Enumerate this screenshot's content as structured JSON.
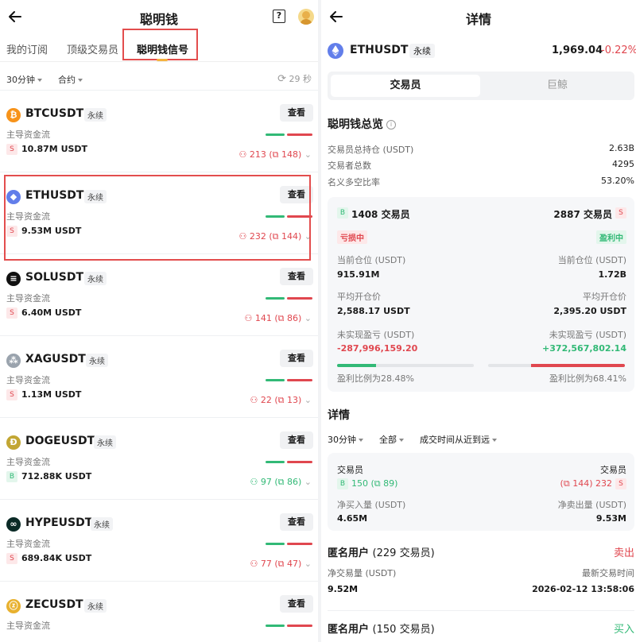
{
  "left": {
    "title": "聪明钱",
    "tabs": [
      "我的订阅",
      "顶级交易员",
      "聪明钱信号"
    ],
    "filters": {
      "interval": "30分钟",
      "type": "合约",
      "refresh": "29 秒"
    },
    "flow_label": "主导资金流",
    "perp_label": "永续",
    "view_label": "查看",
    "coins": [
      {
        "symbol": "BTCUSDT",
        "side": "S",
        "flow": "10.87M USDT",
        "traders": "213",
        "whales": "148",
        "direction": "sell",
        "icon": "btc-icon",
        "icon_color": "#f7931a",
        "glyph": "₿"
      },
      {
        "symbol": "ETHUSDT",
        "side": "S",
        "flow": "9.53M USDT",
        "traders": "232",
        "whales": "144",
        "direction": "sell",
        "icon": "eth-icon",
        "icon_color": "#627eea",
        "glyph": "◆"
      },
      {
        "symbol": "SOLUSDT",
        "side": "S",
        "flow": "6.40M USDT",
        "traders": "141",
        "whales": "86",
        "direction": "sell",
        "icon": "sol-icon",
        "icon_color": "#111111",
        "glyph": "≡"
      },
      {
        "symbol": "XAGUSDT",
        "side": "S",
        "flow": "1.13M USDT",
        "traders": "22",
        "whales": "13",
        "direction": "sell",
        "icon": "xag-icon",
        "icon_color": "#9aa3ad",
        "glyph": "⁂"
      },
      {
        "symbol": "DOGEUSDT",
        "side": "B",
        "flow": "712.88K USDT",
        "traders": "97",
        "whales": "86",
        "direction": "buy",
        "icon": "doge-icon",
        "icon_color": "#c2a633",
        "glyph": "Ð"
      },
      {
        "symbol": "HYPEUSDT",
        "side": "S",
        "flow": "689.84K USDT",
        "traders": "77",
        "whales": "47",
        "direction": "sell",
        "icon": "hype-icon",
        "icon_color": "#0a2a26",
        "glyph": "∞"
      },
      {
        "symbol": "ZECUSDT",
        "side": "S",
        "flow": "",
        "traders": "",
        "whales": "",
        "direction": "sell",
        "icon": "zec-icon",
        "icon_color": "#e8b12f",
        "glyph": "ⓩ"
      }
    ]
  },
  "right": {
    "title": "详情",
    "symbol": "ETHUSDT",
    "perp_label": "永续",
    "price": "1,969.04",
    "change": "-0.22%",
    "segments": [
      "交易员",
      "巨鲸"
    ],
    "overview": {
      "title": "聪明钱总览",
      "rows": [
        {
          "label": "交易员总持仓 (USDT)",
          "value": "2.63B"
        },
        {
          "label": "交易者总数",
          "value": "4295"
        },
        {
          "label": "名义多空比率",
          "value": "53.20%"
        }
      ]
    },
    "card1": {
      "left_count": "1408 交易员",
      "right_count": "2887 交易员",
      "left_side": "B",
      "right_side": "S",
      "left_tag": "亏损中",
      "right_tag": "盈利中",
      "position_label": "当前仓位 (USDT)",
      "left_position": "915.91M",
      "right_position": "1.72B",
      "avg_label": "平均开仓价",
      "left_avg": "2,588.17 USDT",
      "right_avg": "2,395.20 USDT",
      "pnl_label": "未实现盈亏 (USDT)",
      "left_pnl": "-287,996,159.20",
      "right_pnl": "+372,567,802.14",
      "left_ratio_text": "盈利比例为28.48%",
      "right_ratio_text": "盈利比例为68.41%",
      "left_ratio": 0.2848,
      "right_ratio": 0.6841
    },
    "details": {
      "title": "详情",
      "filters": [
        "30分钟",
        "全部",
        "成交时间从近到远"
      ],
      "card_left_label": "交易员",
      "card_right_label": "交易员",
      "left_side": "B",
      "left_traders": "150",
      "left_whales": "89",
      "right_traders": "232",
      "right_whales": "144",
      "right_side": "S",
      "buy_label": "净买入量 (USDT)",
      "sell_label": "净卖出量 (USDT)",
      "buy_value": "4.65M",
      "sell_value": "9.53M"
    },
    "users": [
      {
        "name": "匿名用户",
        "count": "(229 交易员)",
        "side": "卖出",
        "vol_label": "净交易量 (USDT)",
        "vol": "9.52M",
        "time_label": "最新交易时间",
        "time": "2026-02-12 13:58:06"
      },
      {
        "name": "匿名用户",
        "count": "(150 交易员)",
        "side": "买入"
      }
    ],
    "colors": {
      "buy": "#32b976",
      "sell": "#e0474f",
      "highlight": "#e34d4d"
    }
  }
}
